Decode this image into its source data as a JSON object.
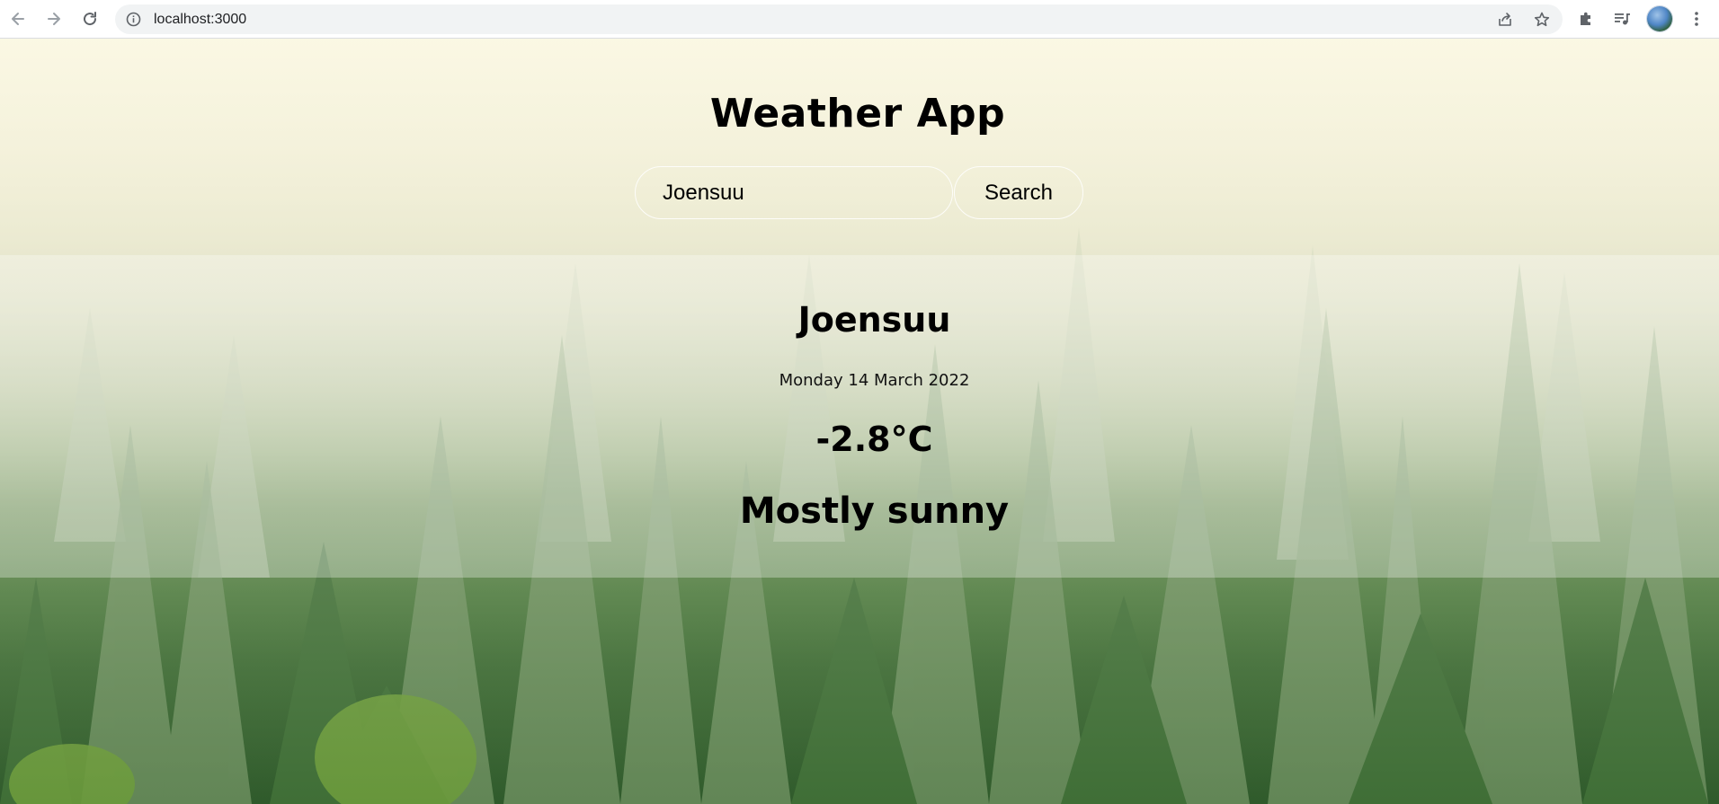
{
  "browser": {
    "url": "localhost:3000",
    "icons": {
      "back": "arrow-left-icon",
      "forward": "arrow-right-icon",
      "reload": "reload-icon",
      "site_info": "info-icon",
      "share": "share-icon",
      "bookmark": "star-icon",
      "extensions": "puzzle-icon",
      "media": "media-playlist-icon",
      "profile": "avatar",
      "menu": "kebab-menu-icon"
    }
  },
  "app": {
    "title": "Weather App",
    "search": {
      "value": "Joensuu",
      "button_label": "Search"
    },
    "weather": {
      "city": "Joensuu",
      "date": "Monday 14 March 2022",
      "temperature": "-2.8°C",
      "condition": "Mostly sunny"
    }
  },
  "colors": {
    "text": "#000000",
    "panel_overlay": "rgba(255,255,255,0.30)",
    "input_border": "#ffffff"
  }
}
